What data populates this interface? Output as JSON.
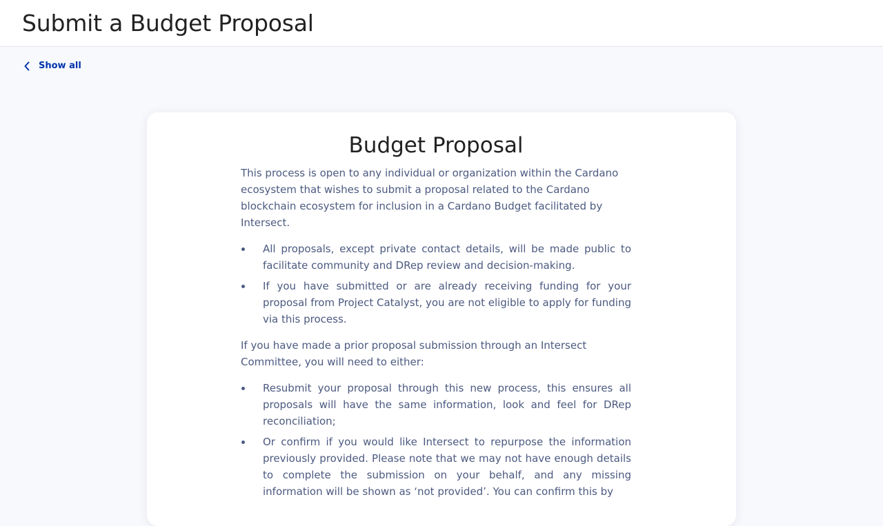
{
  "header": {
    "title": "Submit a Budget Proposal"
  },
  "nav": {
    "back_label": "Show all",
    "back_icon": "chevron-left-icon"
  },
  "colors": {
    "accent": "#0033ad",
    "body_text": "#4c5a80",
    "heading": "#212121",
    "background": "#f8f9fc"
  },
  "card": {
    "title": "Budget Proposal",
    "intro": "This process is open to any individual or organization within the Cardano ecosystem that wishes to submit a proposal related to the Cardano blockchain ecosystem for inclusion in a Cardano Budget facilitated by Intersect.",
    "bullets_1": [
      "All proposals, except private contact details, will be made public to facilitate community and DRep review and decision-making.",
      "If you have submitted or are already receiving funding for your proposal from Project Catalyst, you are not eligible to apply for funding via this process."
    ],
    "prior_submission": "If you have made a prior proposal submission through an Intersect Committee, you will need to either:",
    "bullets_2": [
      "Resubmit your proposal through this new process, this ensures all proposals will have the same information, look and feel for DRep reconciliation;",
      "Or confirm if you would like Intersect to repurpose the information previously provided. Please note that we may not have enough details to complete the submission on your behalf, and any missing information will be shown as ‘not provided’. You can confirm this by"
    ]
  }
}
